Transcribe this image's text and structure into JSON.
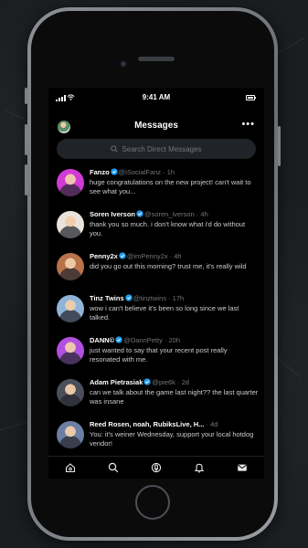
{
  "status_bar": {
    "time": "9:41 AM"
  },
  "header": {
    "title": "Messages",
    "more_icon": "more-horizontal-icon"
  },
  "search": {
    "placeholder": "Search Direct Messages"
  },
  "conversations": [
    {
      "name": "Fanzo",
      "handle": "@iSocialFanz",
      "time": "· 1h",
      "verified": true,
      "message": "huge congratulations on the new project! can't wait to see what you...",
      "avatar_color": "#d13ad4"
    },
    {
      "name": "Soren Iverson",
      "handle": "@soren_iverson",
      "time": "· 4h",
      "verified": true,
      "message": "thank you so much. i don't know what i'd do without you.",
      "avatar_color": "#e8e4dc"
    },
    {
      "name": "Penny2x",
      "handle": "@imPenny2x",
      "time": "· 4h",
      "verified": true,
      "message": "did you go out this morning? trust me, it's really wild",
      "avatar_color": "#b8734a"
    },
    {
      "name": "Tinz Twins",
      "handle": "@tinztwins",
      "time": "· 17h",
      "verified": true,
      "message": "wow i can't believe it's been so long since we last talked.",
      "avatar_color": "#8fb4d8"
    },
    {
      "name": "DANN",
      "name_suffix": "©",
      "handle": "@DannPetty",
      "time": "· 20h",
      "verified": true,
      "message": "just wanted to say that your recent post really resonated with me.",
      "avatar_color": "#b14fe0"
    },
    {
      "name": "Adam Pietrasiak",
      "handle": "@pie6k",
      "time": "· 2d",
      "verified": true,
      "message": "can we talk about the game last night?? the last quarter was insane",
      "avatar_color": "#4a4f5a"
    },
    {
      "name": "Reed Rosen, noah, RubiksLive, H...",
      "handle": "",
      "time": "· 4d",
      "verified": false,
      "message": "You: it's weiner Wednesday, support your local hotdog vendor!",
      "avatar_color": "#6b7ea3"
    }
  ],
  "tabbar": {
    "items": [
      {
        "name": "home",
        "icon": "home-icon"
      },
      {
        "name": "search",
        "icon": "search-icon"
      },
      {
        "name": "spaces",
        "icon": "spaces-icon"
      },
      {
        "name": "notifications",
        "icon": "bell-icon"
      },
      {
        "name": "messages",
        "icon": "envelope-icon",
        "active": true
      }
    ]
  },
  "colors": {
    "background": "#000000",
    "accent": "#1d9bf0",
    "muted": "#71767b"
  }
}
